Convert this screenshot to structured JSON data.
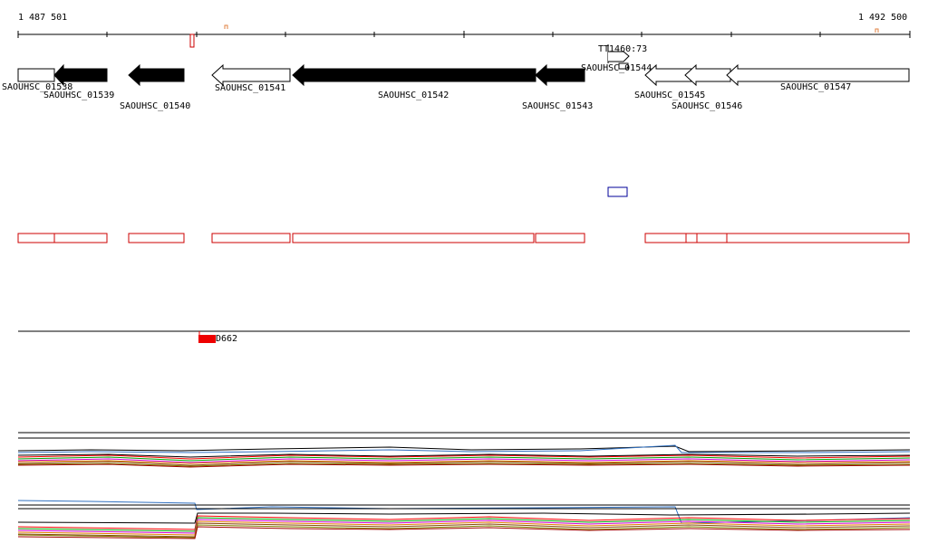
{
  "genome_browser": {
    "coord_start": "1 487 501",
    "coord_end": "1 492 500",
    "terminator_label": "TT1460:73",
    "feature_label": "D662",
    "colors": {
      "gene_reverse": "#000000",
      "gene_forward_fill": "#ffffff",
      "gene_outline": "#000000",
      "cds_box": "#cc0000",
      "tss_box": "#000099",
      "feature_fill": "#ee0000",
      "axis": "#000000"
    },
    "genes": [
      {
        "label": "SAOUHSC_01538",
        "strand": "+",
        "shape": "box"
      },
      {
        "label": "SAOUHSC_01539",
        "strand": "-",
        "shape": "arrow-left"
      },
      {
        "label": "SAOUHSC_01540",
        "strand": "-",
        "shape": "arrow-left"
      },
      {
        "label": "SAOUHSC_01541",
        "strand": "-",
        "shape": "arrow-left-open"
      },
      {
        "label": "SAOUHSC_01542",
        "strand": "-",
        "shape": "arrow-left"
      },
      {
        "label": "SAOUHSC_01543",
        "strand": "-",
        "shape": "arrow-left"
      },
      {
        "label": "SAOUHSC_01544",
        "strand": "+",
        "shape": "arrow-right-open"
      },
      {
        "label": "SAOUHSC_01545",
        "strand": "-",
        "shape": "arrow-left-open"
      },
      {
        "label": "SAOUHSC_01546",
        "strand": "-",
        "shape": "arrow-left-open"
      },
      {
        "label": "SAOUHSC_01547",
        "strand": "-",
        "shape": "arrow-left-open"
      }
    ]
  }
}
